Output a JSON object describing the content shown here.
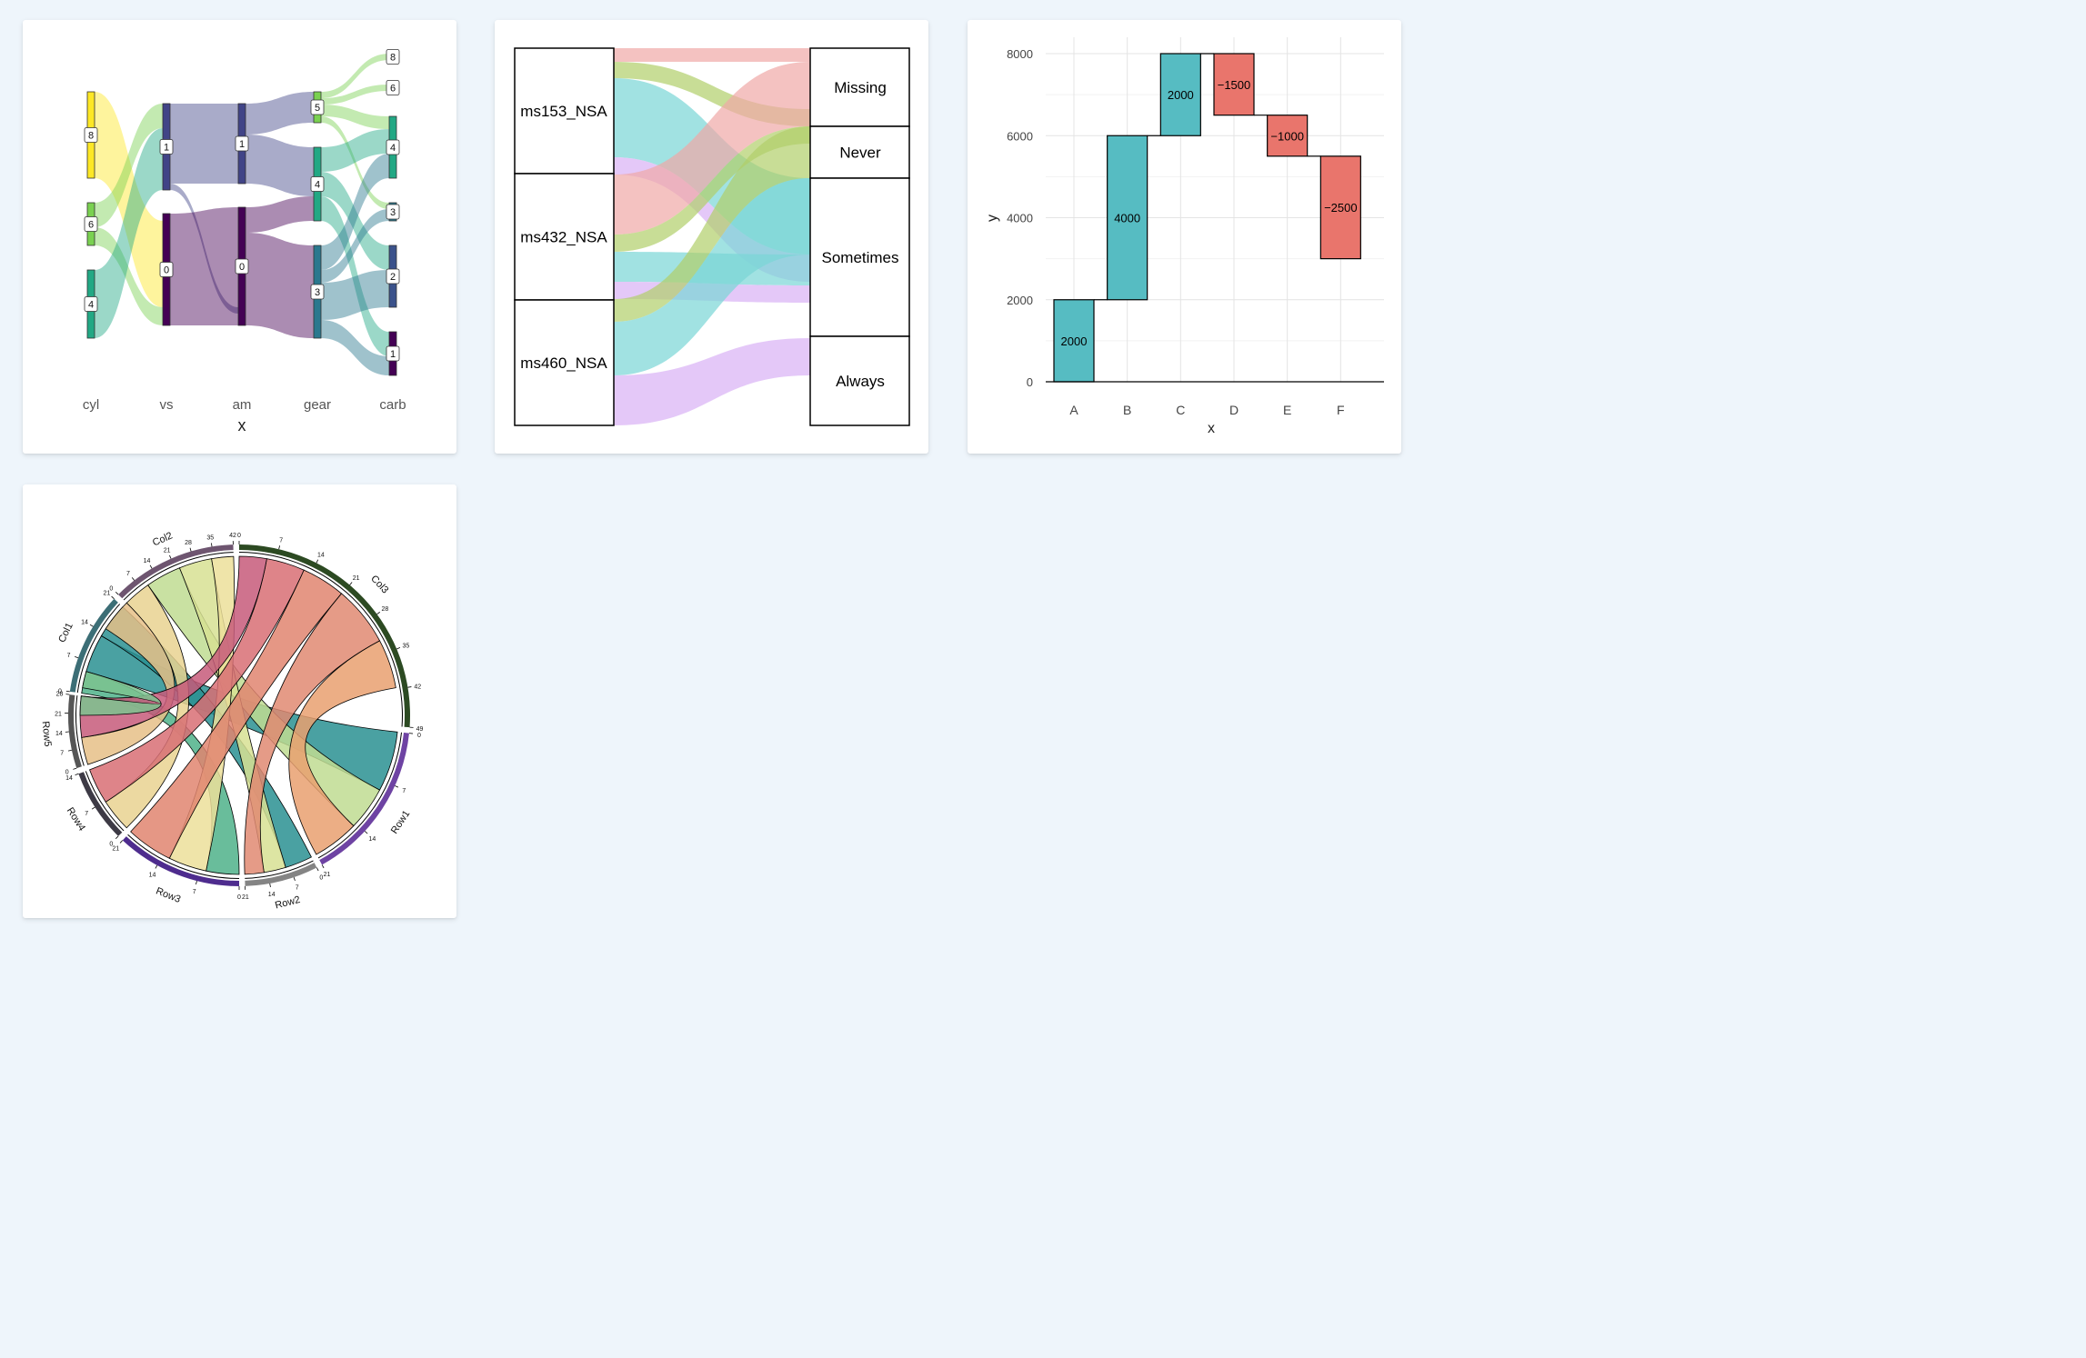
{
  "chart_data": [
    {
      "type": "alluvial",
      "xlabel": "x",
      "axes": [
        "cyl",
        "vs",
        "am",
        "gear",
        "carb"
      ],
      "strata": {
        "cyl": [
          {
            "label": "8",
            "count": 14,
            "color": "#FDE725"
          },
          {
            "label": "6",
            "count": 7,
            "color": "#7AD151"
          },
          {
            "label": "4",
            "count": 11,
            "color": "#22A884"
          }
        ],
        "vs": [
          {
            "label": "1",
            "count": 14,
            "color": "#414487"
          },
          {
            "label": "0",
            "count": 18,
            "color": "#440154"
          }
        ],
        "am": [
          {
            "label": "1",
            "count": 13,
            "color": "#414487"
          },
          {
            "label": "0",
            "count": 19,
            "color": "#440154"
          }
        ],
        "gear": [
          {
            "label": "5",
            "count": 5,
            "color": "#7AD151"
          },
          {
            "label": "4",
            "count": 12,
            "color": "#22A884"
          },
          {
            "label": "3",
            "count": 15,
            "color": "#2A788E"
          }
        ],
        "carb": [
          {
            "label": "8",
            "count": 1,
            "color": "#A0DA39"
          },
          {
            "label": "6",
            "count": 1,
            "color": "#A0DA39"
          },
          {
            "label": "4",
            "count": 10,
            "color": "#22A884"
          },
          {
            "label": "3",
            "count": 3,
            "color": "#2A788E"
          },
          {
            "label": "2",
            "count": 10,
            "color": "#3B528B"
          },
          {
            "label": "1",
            "count": 7,
            "color": "#440154"
          }
        ]
      }
    },
    {
      "type": "alluvial",
      "left_strata": [
        "ms153_NSA",
        "ms432_NSA",
        "ms460_NSA"
      ],
      "right_strata": [
        "Missing",
        "Never",
        "Sometimes",
        "Always"
      ],
      "colors": {
        "Missing": "#F0A8A6",
        "Never": "#B0CF6A",
        "Sometimes": "#79D5D6",
        "Always": "#D9B0F5"
      }
    },
    {
      "type": "waterfall",
      "xlabel": "x",
      "ylabel": "y",
      "categories": [
        "A",
        "B",
        "C",
        "D",
        "E",
        "F"
      ],
      "values": [
        2000,
        4000,
        2000,
        -1500,
        -1000,
        -2500
      ],
      "value_labels": [
        "2000",
        "4000",
        "2000",
        "−1500",
        "−1000",
        "−2500"
      ],
      "ylim": [
        0,
        8000
      ],
      "yticks": [
        "0",
        "2000",
        "4000",
        "6000",
        "8000"
      ],
      "colors": {
        "positive": "#56BCC2",
        "negative": "#E9756C"
      }
    },
    {
      "type": "chord",
      "sectors": [
        {
          "name": "Col1",
          "max": 21,
          "color": "#3C6E76",
          "ticks": [
            "0",
            "7",
            "14",
            "21"
          ]
        },
        {
          "name": "Col2",
          "max": 42,
          "color": "#6E5570",
          "ticks": [
            "0",
            "7",
            "14",
            "21",
            "28",
            "35",
            "42"
          ]
        },
        {
          "name": "Col3",
          "max": 49,
          "color": "#2C4A22",
          "ticks": [
            "0",
            "7",
            "14",
            "21",
            "28",
            "35",
            "42",
            "49"
          ]
        },
        {
          "name": "Row1",
          "max": 21,
          "color": "#6E43A3",
          "ticks": [
            "0",
            "7",
            "14",
            "21"
          ]
        },
        {
          "name": "Row2",
          "max": 21,
          "color": "#848484",
          "ticks": [
            "0",
            "7",
            "14",
            "21"
          ]
        },
        {
          "name": "Row3",
          "max": 21,
          "color": "#4E2C8E",
          "ticks": [
            "0",
            "7",
            "14",
            "21"
          ]
        },
        {
          "name": "Row4",
          "max": 14,
          "color": "#3D3A45",
          "ticks": [
            "0",
            "7",
            "14"
          ]
        },
        {
          "name": "Row5",
          "max": 28,
          "color": "#555555",
          "ticks": [
            "0",
            "7",
            "14",
            "21",
            "28"
          ]
        }
      ],
      "links": [
        {
          "from": "Row1",
          "to": "Col1",
          "value": 7,
          "color": "#2A9092"
        },
        {
          "from": "Row1",
          "to": "Col2",
          "value": 7,
          "color": "#BFDC92"
        },
        {
          "from": "Row1",
          "to": "Col3",
          "value": 7,
          "color": "#E9A070"
        },
        {
          "from": "Row2",
          "to": "Col1",
          "value": 7,
          "color": "#2A9092"
        },
        {
          "from": "Row2",
          "to": "Col2",
          "value": 7,
          "color": "#D7E193"
        },
        {
          "from": "Row2",
          "to": "Col3",
          "value": 7,
          "color": "#E08A72"
        },
        {
          "from": "Row3",
          "to": "Col1",
          "value": 7,
          "color": "#4FB28A"
        },
        {
          "from": "Row3",
          "to": "Col2",
          "value": 7,
          "color": "#ECDF9A"
        },
        {
          "from": "Row3",
          "to": "Col3",
          "value": 7,
          "color": "#E08570"
        },
        {
          "from": "Row4",
          "to": "Col2",
          "value": 7,
          "color": "#E9D291"
        },
        {
          "from": "Row4",
          "to": "Col3",
          "value": 7,
          "color": "#D86E74"
        },
        {
          "from": "Row5",
          "to": "Col2",
          "value": 7,
          "color": "#E6C087"
        },
        {
          "from": "Row5",
          "to": "Col3",
          "value": 14,
          "color": "#C75B7A"
        },
        {
          "from": "Row5",
          "to": "Col1",
          "value": 7,
          "color": "#7CC38F"
        }
      ]
    }
  ]
}
